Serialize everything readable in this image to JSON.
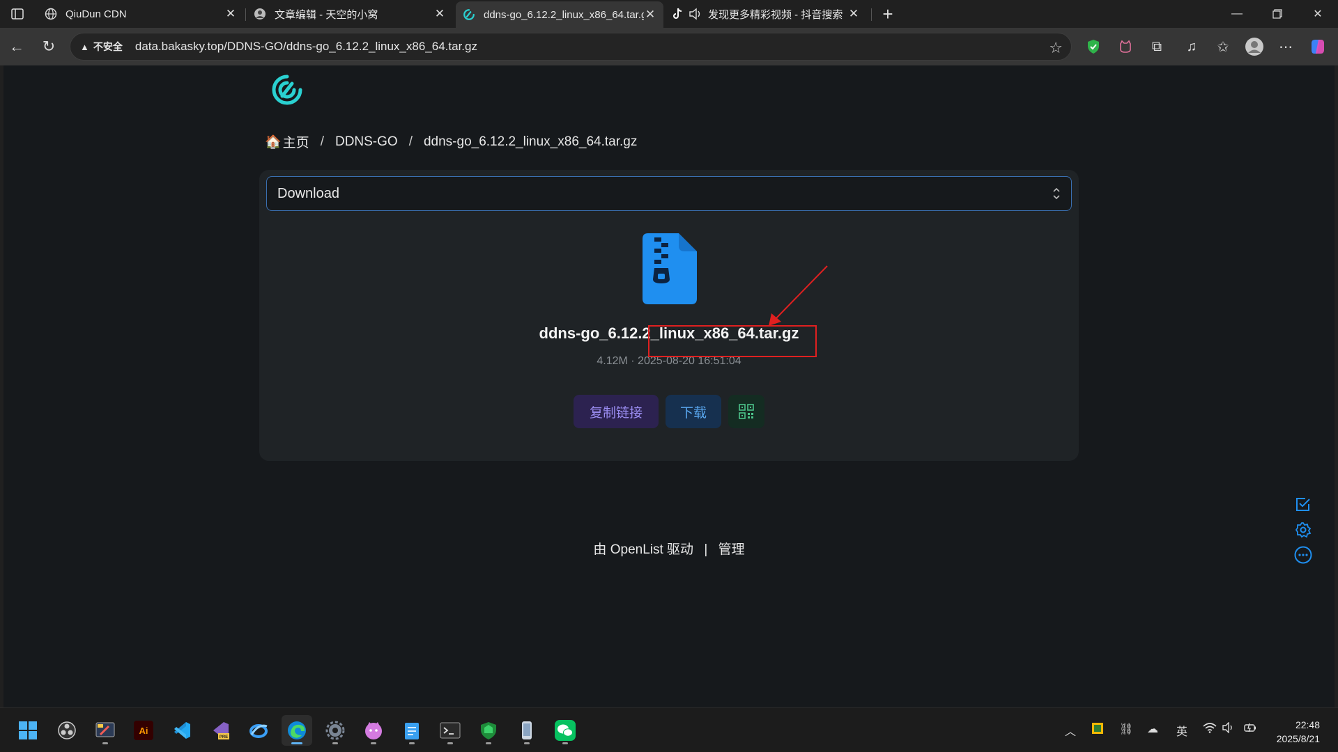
{
  "tabs": [
    {
      "title": "QiuDun CDN",
      "icon": "globe-icon"
    },
    {
      "title": "文章编辑 - 天空的小窝",
      "icon": "avatar-icon"
    },
    {
      "title": "ddns-go_6.12.2_linux_x86_64.tar.gz",
      "icon": "openlist-icon",
      "active": true
    },
    {
      "title": "发现更多精彩视频 - 抖音搜索",
      "icon": "tiktok-icon"
    }
  ],
  "address_bar": {
    "security_label": "不安全",
    "url": "data.bakasky.top/DDNS-GO/ddns-go_6.12.2_linux_x86_64.tar.gz"
  },
  "breadcrumb": {
    "home": "主页",
    "folder": "DDNS-GO",
    "file": "ddns-go_6.12.2_linux_x86_64.tar.gz"
  },
  "preview": {
    "selected_mode": "Download"
  },
  "file": {
    "name": "ddns-go_6.12.2_linux_x86_64.tar.gz",
    "meta": "4.12M · 2025-08-20 16:51:04"
  },
  "actions": {
    "copy_link": "复制链接",
    "download": "下载"
  },
  "footer": {
    "powered_prefix": "由",
    "brand": "OpenList",
    "powered_suffix": "驱动",
    "separator": "|",
    "manage": "管理"
  },
  "taskbar": {
    "time": "22:48",
    "date": "2025/8/21",
    "ime": "英",
    "adobe_label": "Ai",
    "vs_label": "PRE"
  },
  "colors": {
    "accent": "#1f8ff0",
    "annotation": "#e02020",
    "logo": "#2ad1d1"
  }
}
